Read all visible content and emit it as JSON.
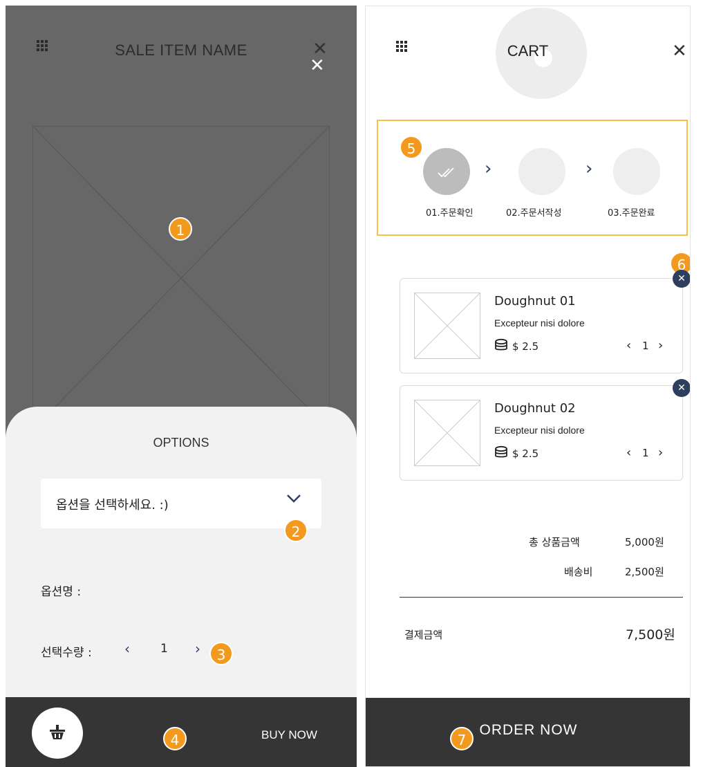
{
  "product_screen": {
    "title": "SALE ITEM NAME",
    "icons": {
      "menu": "grid-menu-icon",
      "close": "close-icon"
    },
    "image": "placeholder-image",
    "options_sheet": {
      "title": "OPTIONS",
      "select_value": "옵션을 선택하세요. :)",
      "option_name_label": "옵션명 :",
      "quantity_label": "선택수량 :",
      "quantity_value": "1",
      "prev_glyph": "‹",
      "next_glyph": "›"
    },
    "bottom_bar": {
      "buy_label": "BUY NOW",
      "cart_icon": "basket-icon"
    }
  },
  "cart_screen": {
    "title": "CART",
    "steps": [
      {
        "label": "01.주문확인",
        "status": "done"
      },
      {
        "label": "02.주문서작성",
        "status": "pending"
      },
      {
        "label": "03.주문완료",
        "status": "pending"
      }
    ],
    "items": [
      {
        "name": "Doughnut 01",
        "description": "Excepteur nisi dolore",
        "price": "$ 2.5",
        "quantity": "1"
      },
      {
        "name": "Doughnut 02",
        "description": "Excepteur nisi dolore",
        "price": "$ 2.5",
        "quantity": "1"
      }
    ],
    "summary": {
      "subtotal_label": "총 상품금액",
      "subtotal_value": "5,000원",
      "shipping_label": "배송비",
      "shipping_value": "2,500원",
      "total_label": "결제금액",
      "total_value": "7,500원"
    },
    "bottom_bar": {
      "order_label": "ORDER NOW"
    }
  },
  "annotations": [
    "1",
    "2",
    "3",
    "4",
    "5",
    "6",
    "7"
  ],
  "colors": {
    "accent": "#f39a1e",
    "highlight_border": "#f5c242",
    "navy": "#2d3e5e",
    "overlay": "#676767",
    "bar": "#353535"
  }
}
